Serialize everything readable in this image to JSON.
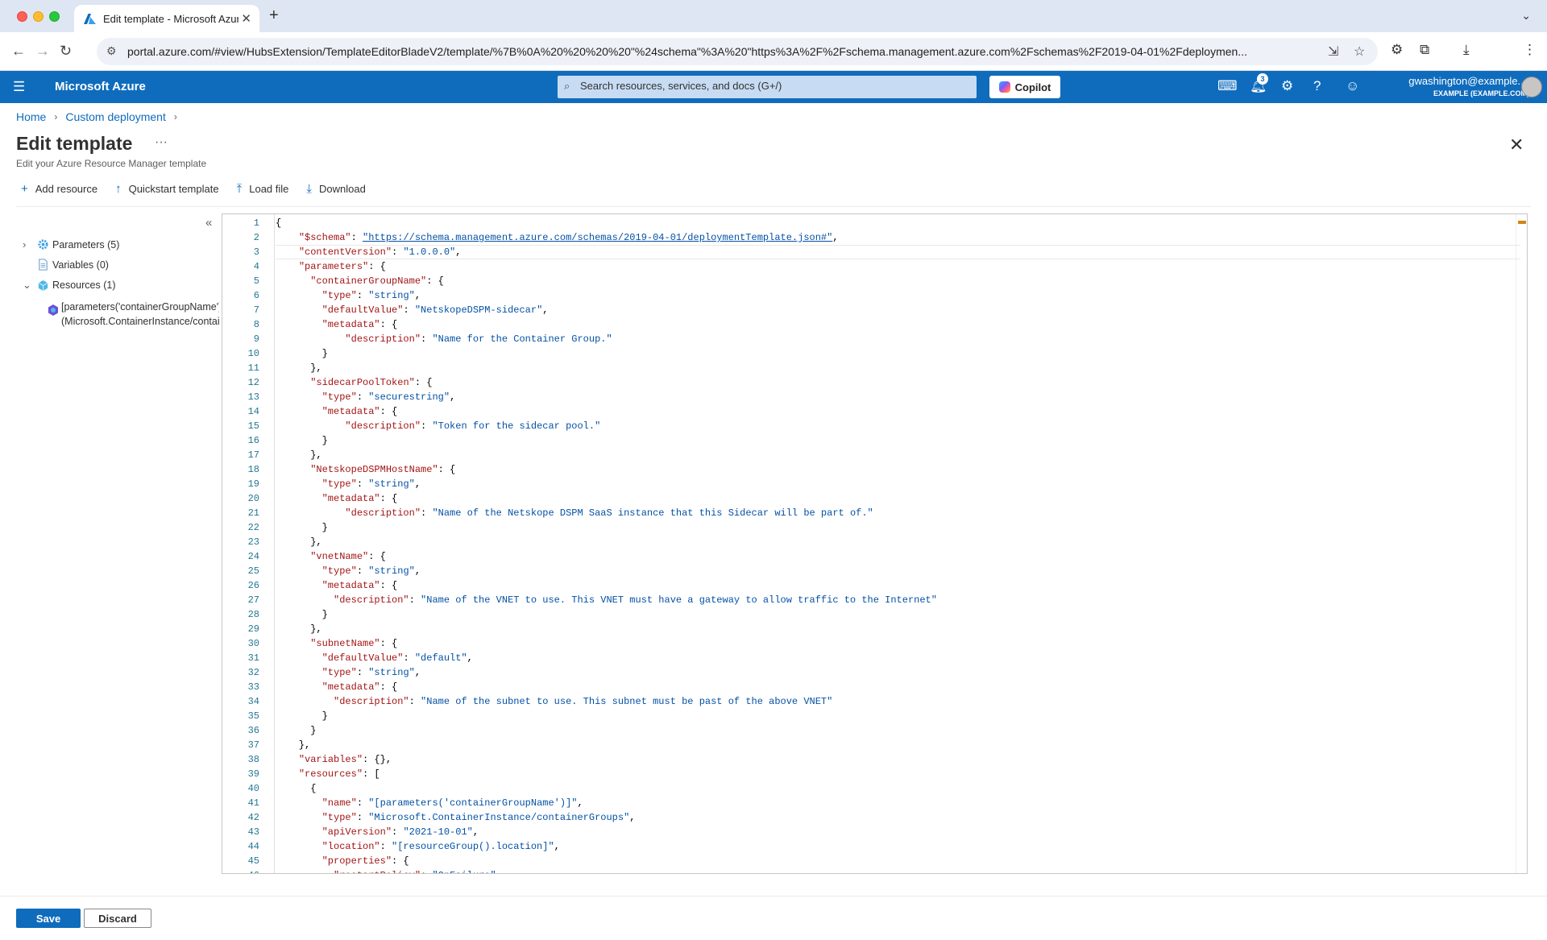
{
  "browser": {
    "tab_title": "Edit template - Microsoft Azure",
    "new_tab_symbol": "+",
    "url": "portal.azure.com/#view/HubsExtension/TemplateEditorBladeV2/template/%7B%0A%20%20%20%20\"%24schema\"%3A%20\"https%3A%2F%2Fschema.management.azure.com%2Fschemas%2F2019-04-01%2Fdeploymen..."
  },
  "azure_header": {
    "brand": "Microsoft Azure",
    "search_placeholder": "Search resources, services, and docs (G+/)",
    "copilot_label": "Copilot",
    "notification_count": "3",
    "user_name": "gwashington@example....",
    "user_directory": "EXAMPLE (EXAMPLE.COM)"
  },
  "breadcrumb": {
    "items": [
      "Home",
      "Custom deployment"
    ]
  },
  "page": {
    "title": "Edit template",
    "more": "···",
    "subtitle": "Edit your Azure Resource Manager template"
  },
  "toolbar": {
    "add_resource": "Add resource",
    "quickstart_template": "Quickstart template",
    "load_file": "Load file",
    "download": "Download"
  },
  "tree": {
    "parameters": "Parameters (5)",
    "variables": "Variables (0)",
    "resources": "Resources (1)",
    "resource_line1": "[parameters('containerGroupName')]",
    "resource_line2": "(Microsoft.ContainerInstance/containerGroups)"
  },
  "editor": {
    "lines": [
      "{",
      "    \"$schema\": \"https://schema.management.azure.com/schemas/2019-04-01/deploymentTemplate.json#\",",
      "    \"contentVersion\": \"1.0.0.0\",",
      "    \"parameters\": {",
      "      \"containerGroupName\": {",
      "        \"type\": \"string\",",
      "        \"defaultValue\": \"NetskopeDSPM-sidecar\",",
      "        \"metadata\": {",
      "            \"description\": \"Name for the Container Group.\"",
      "        }",
      "      },",
      "      \"sidecarPoolToken\": {",
      "        \"type\": \"securestring\",",
      "        \"metadata\": {",
      "            \"description\": \"Token for the sidecar pool.\"",
      "        }",
      "      },",
      "      \"NetskopeDSPMHostName\": {",
      "        \"type\": \"string\",",
      "        \"metadata\": {",
      "            \"description\": \"Name of the Netskope DSPM SaaS instance that this Sidecar will be part of.\"",
      "        }",
      "      },",
      "      \"vnetName\": {",
      "        \"type\": \"string\",",
      "        \"metadata\": {",
      "          \"description\": \"Name of the VNET to use. This VNET must have a gateway to allow traffic to the Internet\"",
      "        }",
      "      },",
      "      \"subnetName\": {",
      "        \"defaultValue\": \"default\",",
      "        \"type\": \"string\",",
      "        \"metadata\": {",
      "          \"description\": \"Name of the subnet to use. This subnet must be past of the above VNET\"",
      "        }",
      "      }",
      "    },",
      "    \"variables\": {},",
      "    \"resources\": [",
      "      {",
      "        \"name\": \"[parameters('containerGroupName')]\",",
      "        \"type\": \"Microsoft.ContainerInstance/containerGroups\",",
      "        \"apiVersion\": \"2021-10-01\",",
      "        \"location\": \"[resourceGroup().location]\",",
      "        \"properties\": {",
      "          \"restartPolicy\": \"OnFailure\","
    ]
  },
  "footer": {
    "save": "Save",
    "discard": "Discard"
  },
  "colors": {
    "azure_blue": "#0f6cbd",
    "json_key": "#a31515",
    "json_string": "#0451a5",
    "line_number": "#237893"
  }
}
